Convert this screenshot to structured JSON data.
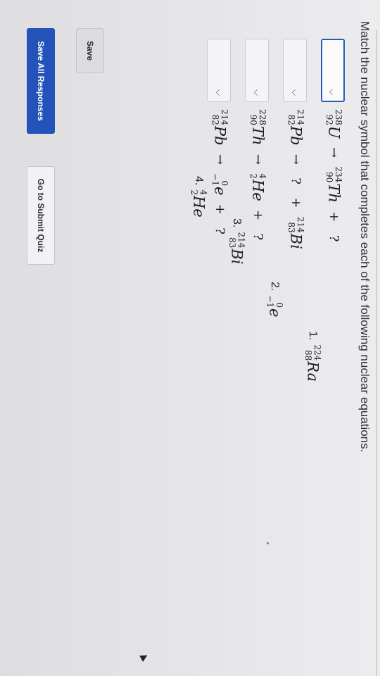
{
  "instruction": "Match the nuclear symbol that completes each of the following nuclear equations.",
  "questions": [
    {
      "id": 1,
      "dropdown": {
        "value": "",
        "icon": "chevron-down-icon",
        "active": true
      },
      "lhs": {
        "mass": "238",
        "atomic": "92",
        "symbol": "U"
      },
      "arrow": "→",
      "products": [
        {
          "mass": "234",
          "atomic": "90",
          "symbol": "Th"
        }
      ],
      "plus": "+",
      "unknown": "?"
    },
    {
      "id": 2,
      "dropdown": {
        "value": "",
        "icon": "chevron-down-icon",
        "active": false
      },
      "lhs": {
        "mass": "214",
        "atomic": "82",
        "symbol": "Pb"
      },
      "arrow": "→",
      "unknown": "?",
      "plus": "+",
      "products": [
        {
          "mass": "214",
          "atomic": "83",
          "symbol": "Bi"
        }
      ]
    },
    {
      "id": 3,
      "dropdown": {
        "value": "",
        "icon": "chevron-down-icon",
        "active": false
      },
      "lhs": {
        "mass": "228",
        "atomic": "90",
        "symbol": "Th"
      },
      "arrow": "→",
      "products": [
        {
          "mass": "4",
          "atomic": "2",
          "symbol": "He"
        }
      ],
      "plus": "+",
      "unknown": "?"
    },
    {
      "id": 4,
      "dropdown": {
        "value": "",
        "icon": "chevron-down-icon",
        "active": false
      },
      "lhs": {
        "mass": "214",
        "atomic": "82",
        "symbol": "Pb"
      },
      "arrow": "→",
      "products": [
        {
          "mass": "0",
          "atomic": "−1",
          "symbol": "e"
        }
      ],
      "plus": "+",
      "unknown": "?"
    }
  ],
  "answers": [
    {
      "num": "1.",
      "mass": "224",
      "atomic": "88",
      "symbol": "Ra"
    },
    {
      "num": "2.",
      "mass": "0",
      "atomic": "−1",
      "symbol": "e"
    },
    {
      "num": "3.",
      "mass": "214",
      "atomic": "83",
      "symbol": "Bi"
    },
    {
      "num": "4.",
      "mass": "4",
      "atomic": "2",
      "symbol": "He"
    }
  ],
  "buttons": {
    "save": "Save",
    "save_all": "Save All Responses",
    "submit": "Go to Submit Quiz"
  },
  "colors": {
    "primary": "#2352b8",
    "active_border": "#2a5db5",
    "background": "#e7e6e9"
  }
}
